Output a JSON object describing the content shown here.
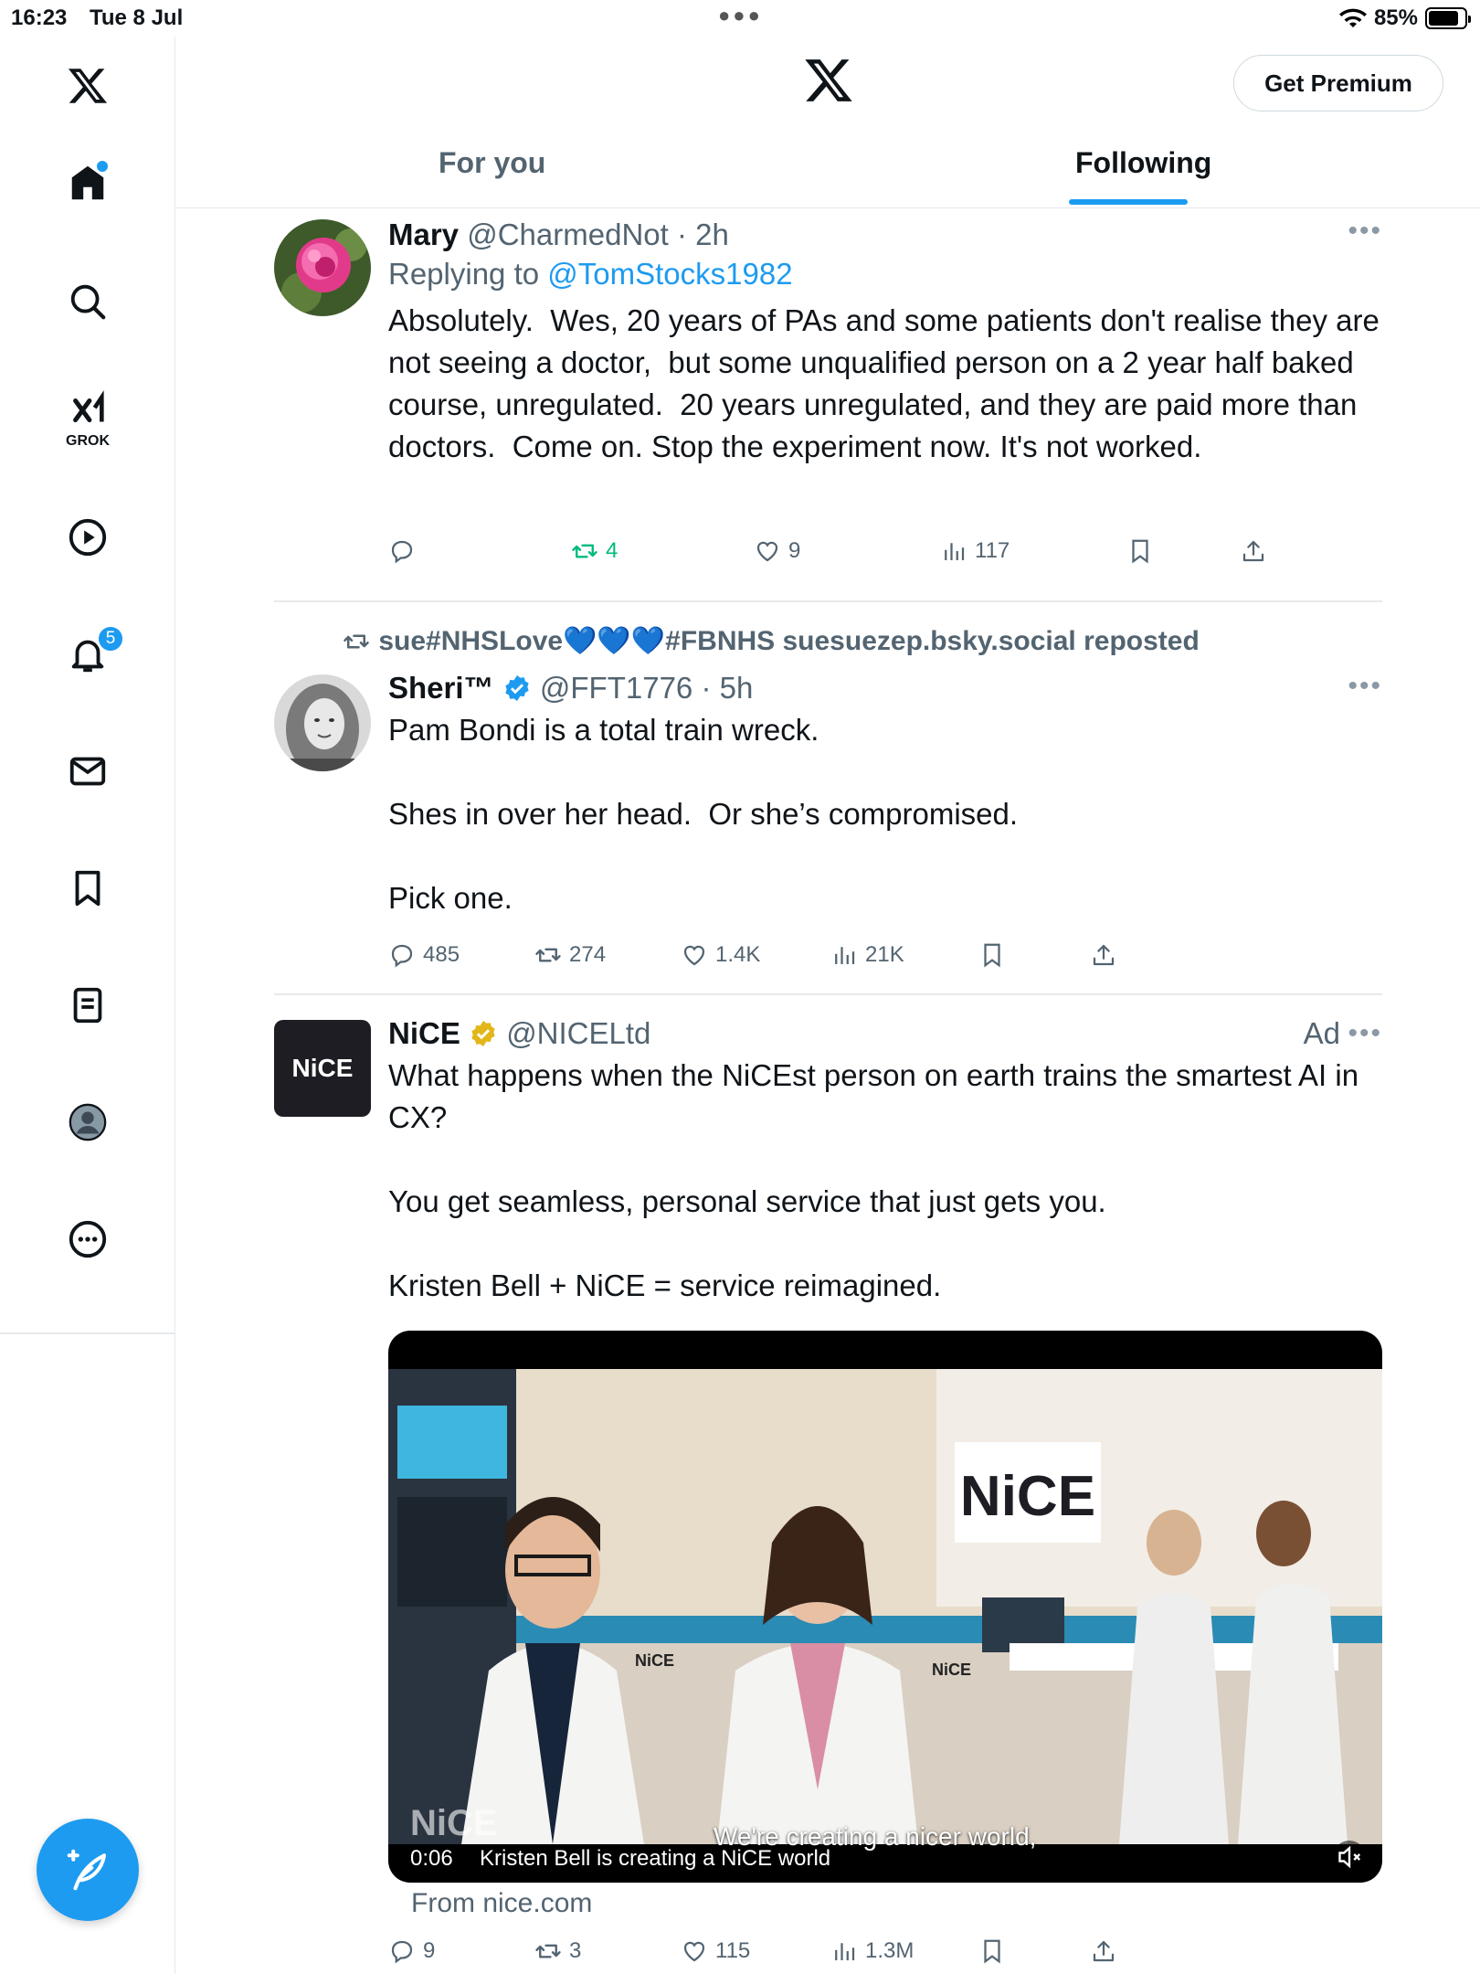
{
  "status_bar": {
    "time": "16:23",
    "date": "Tue 8 Jul",
    "battery": "85%"
  },
  "sidebar": {
    "grok_label": "GROK",
    "notifications_count": "5"
  },
  "header": {
    "premium_label": "Get Premium",
    "tabs": [
      {
        "label": "For you"
      },
      {
        "label": "Following"
      }
    ]
  },
  "tweets": [
    {
      "name": "Mary",
      "handle": "@CharmedNot",
      "time": "2h",
      "replying_prefix": "Replying to",
      "replying_to": "@TomStocks1982",
      "text": "Absolutely.  Wes, 20 years of PAs and some patients don't realise they are not seeing a doctor,  but some unqualified person on a 2 year half baked course, unregulated.  20 years unregulated, and they are paid more than doctors.  Come on. Stop the experiment now. It's not worked.",
      "stats": {
        "replies": "",
        "reposts": "4",
        "likes": "9",
        "views": "117"
      }
    },
    {
      "repost_by": "sue#NHSLove💙💙💙#FBNHS suesuezep.bsky.social reposted",
      "name": "Sheri™",
      "handle": "@FFT1776",
      "time": "5h",
      "text": "Pam Bondi is a total train wreck.\n\nShes in over her head.  Or she’s compromised.\n\nPick one.",
      "stats": {
        "replies": "485",
        "reposts": "274",
        "likes": "1.4K",
        "views": "21K"
      }
    },
    {
      "name": "NiCE",
      "avatar_text": "NiCE",
      "handle": "@NICELtd",
      "ad_label": "Ad",
      "text": "What happens when the NiCEst person on earth trains the smartest AI in CX?\n\nYou get seamless, personal service that just gets you.\n\nKristen Bell + NiCE = service reimagined.",
      "video": {
        "time": "0:06",
        "caption": "Kristen Bell is creating a NiCE world",
        "subtitle": "We're creating a nicer world,",
        "sign_text": "NiCE",
        "watermark": "NiCE",
        "coat_label": "NiCE"
      },
      "from": "From nice.com",
      "stats": {
        "replies": "9",
        "reposts": "3",
        "likes": "115",
        "views": "1.3M"
      }
    }
  ]
}
